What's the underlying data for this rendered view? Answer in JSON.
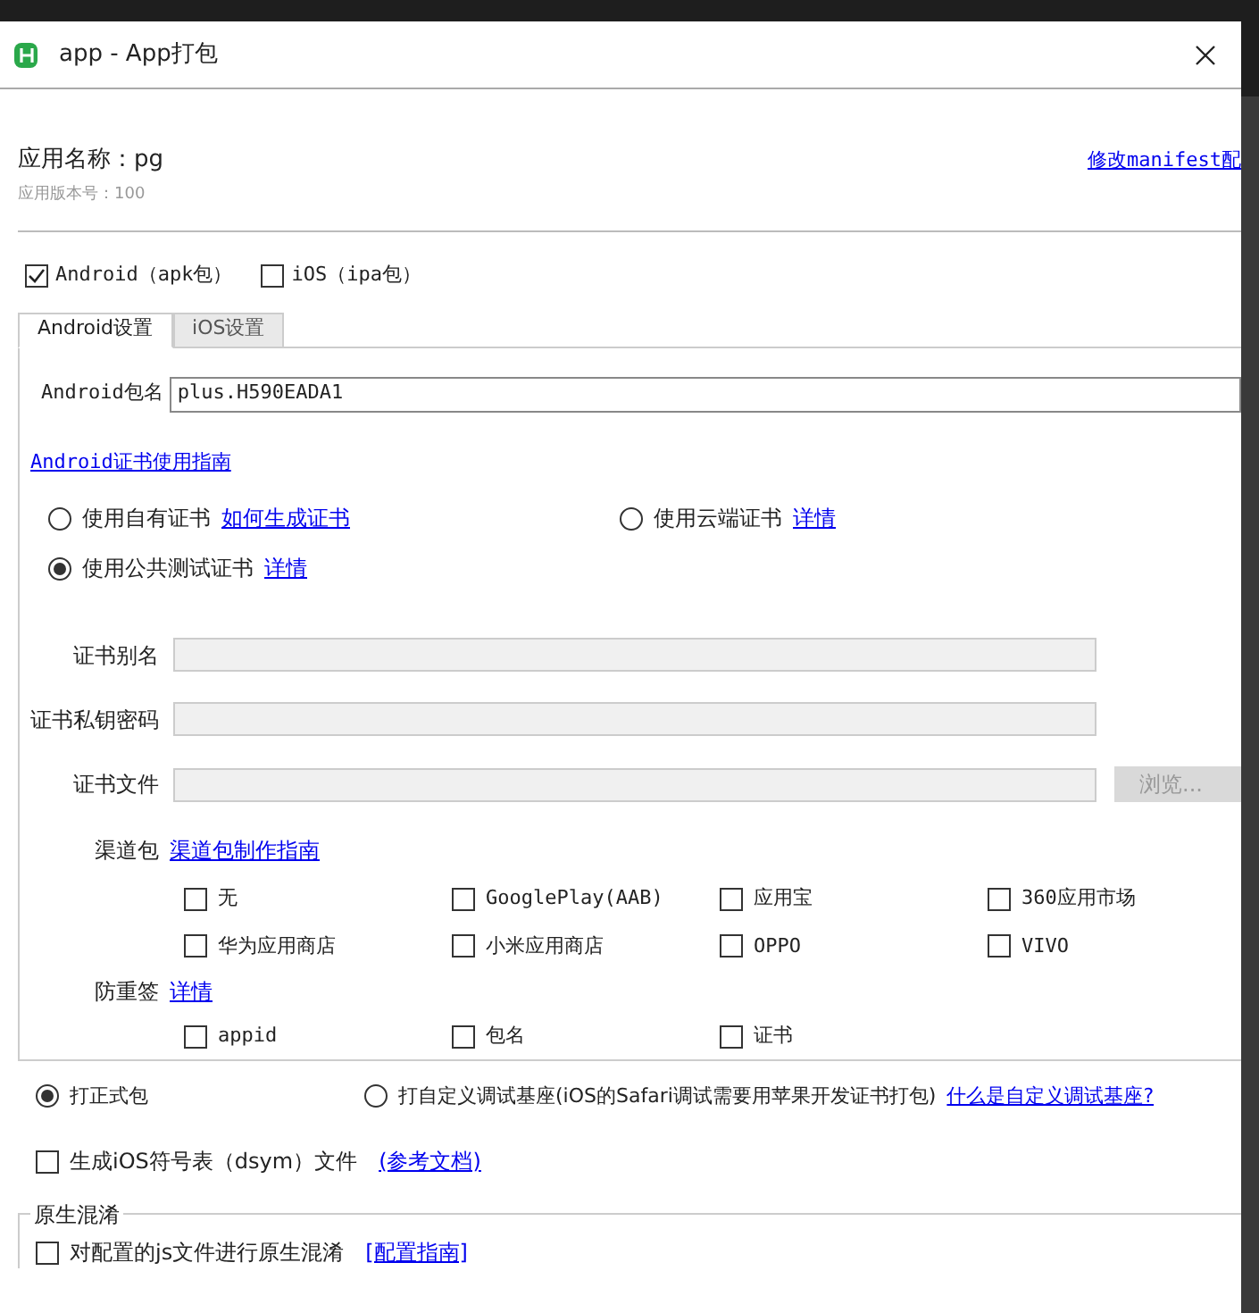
{
  "window": {
    "title": "app - App打包"
  },
  "app": {
    "name_label": "应用名称：pg",
    "version": "应用版本号：100",
    "manifest_link": "修改manifest配"
  },
  "platforms": [
    {
      "label": "Android（apk包）",
      "checked": true
    },
    {
      "label": "iOS（ipa包）",
      "checked": false
    }
  ],
  "tabs": [
    {
      "label": "Android设置",
      "selected": true
    },
    {
      "label": "iOS设置",
      "selected": false
    }
  ],
  "package": {
    "label": "Android包名",
    "value": "plus.H590EADA1"
  },
  "cert_guide_link": "Android证书使用指南",
  "cert_options": [
    {
      "label": "使用自有证书",
      "link": "如何生成证书",
      "selected": false
    },
    {
      "label": "使用云端证书",
      "link": "详情",
      "selected": false
    },
    {
      "label": "使用公共测试证书",
      "link": "详情",
      "selected": true
    }
  ],
  "cert_fields": [
    {
      "label": "证书别名",
      "disabled": true
    },
    {
      "label": "证书私钥密码",
      "disabled": true
    },
    {
      "label": "证书文件",
      "disabled": true,
      "button": "浏览..."
    }
  ],
  "channels": {
    "label": "渠道包",
    "link": "渠道包制作指南",
    "items": [
      {
        "label": "无",
        "checked": false
      },
      {
        "label": "GooglePlay(AAB)",
        "checked": false
      },
      {
        "label": "应用宝",
        "checked": false
      },
      {
        "label": "360应用市场",
        "checked": false
      },
      {
        "label": "华为应用商店",
        "checked": false
      },
      {
        "label": "小米应用商店",
        "checked": false
      },
      {
        "label": "OPPO",
        "checked": false
      },
      {
        "label": "VIVO",
        "checked": false
      }
    ]
  },
  "anti_resign": {
    "label": "防重签",
    "link": "详情",
    "items": [
      {
        "label": "appid",
        "checked": false
      },
      {
        "label": "包名",
        "checked": false
      },
      {
        "label": "证书",
        "checked": false
      }
    ]
  },
  "build_types": [
    {
      "label": "打正式包",
      "selected": true
    },
    {
      "label": "打自定义调试基座(iOS的Safari调试需要用苹果开发证书打包)",
      "selected": false,
      "link": "什么是自定义调试基座?"
    }
  ],
  "dsym": {
    "label": "生成iOS符号表（dsym）文件",
    "checked": false,
    "link": "(参考文档)"
  },
  "obfuscation": {
    "title": "原生混淆",
    "label": "对配置的js文件进行原生混淆",
    "checked": false,
    "link": "[配置指南]"
  }
}
